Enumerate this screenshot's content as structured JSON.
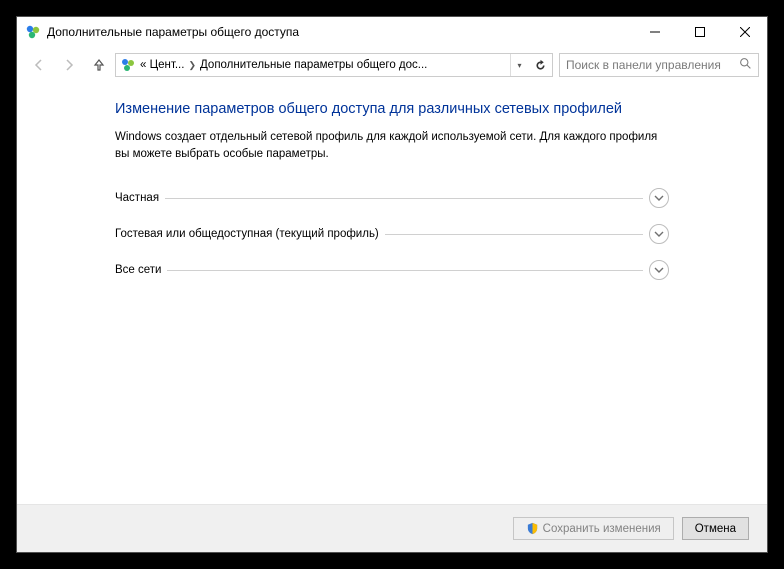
{
  "window": {
    "title": "Дополнительные параметры общего доступа"
  },
  "nav": {
    "breadcrumb_prefix": "«",
    "crumb1": "Цент...",
    "crumb2": "Дополнительные параметры общего дос...",
    "search_placeholder": "Поиск в панели управления"
  },
  "main": {
    "title": "Изменение параметров общего доступа для различных сетевых профилей",
    "description": "Windows создает отдельный сетевой профиль для каждой используемой сети. Для каждого профиля вы можете выбрать особые параметры.",
    "sections": [
      {
        "label": "Частная"
      },
      {
        "label": "Гостевая или общедоступная (текущий профиль)"
      },
      {
        "label": "Все сети"
      }
    ]
  },
  "footer": {
    "save_label": "Сохранить изменения",
    "cancel_label": "Отмена"
  }
}
